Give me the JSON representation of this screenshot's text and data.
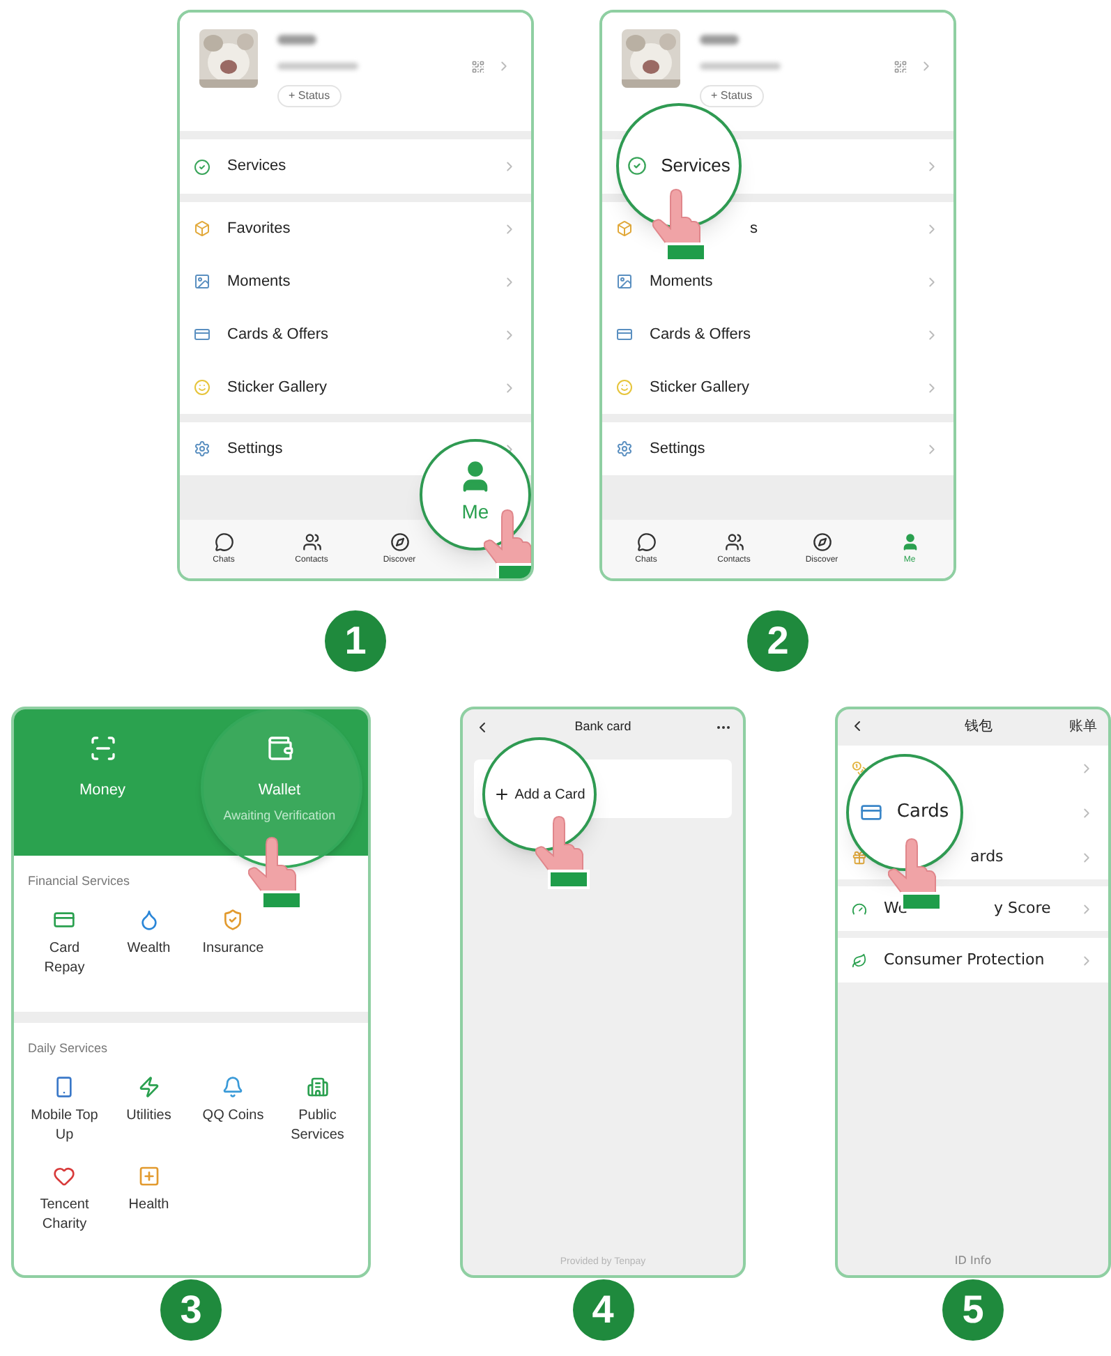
{
  "screens": [
    {
      "kind": "profile",
      "step": "1",
      "status_button": "+ Status",
      "sections": [
        [
          {
            "label": "Services",
            "magnified": false
          }
        ],
        [
          {
            "label": "Favorites",
            "magnified": false
          },
          {
            "label": "Moments",
            "magnified": false
          },
          {
            "label": "Cards & Offers",
            "magnified": false
          },
          {
            "label": "Sticker Gallery",
            "magnified": false
          }
        ],
        [
          {
            "label": "Settings",
            "magnified": false
          }
        ]
      ],
      "tabs": [
        {
          "label": "Chats",
          "selected": false,
          "magnified": false
        },
        {
          "label": "Contacts",
          "selected": false,
          "magnified": false
        },
        {
          "label": "Discover",
          "selected": false,
          "magnified": false
        },
        {
          "label": "Me",
          "selected": true,
          "magnified": true
        }
      ]
    },
    {
      "kind": "profile",
      "step": "2",
      "status_button": "+ Status",
      "sections": [
        [
          {
            "label": "Services",
            "magnified": true
          }
        ],
        [
          {
            "label_tail": "s",
            "magnified": false
          },
          {
            "label": "Moments",
            "magnified": false
          },
          {
            "label": "Cards & Offers",
            "magnified": false
          },
          {
            "label": "Sticker Gallery",
            "magnified": false
          }
        ],
        [
          {
            "label": "Settings",
            "magnified": false
          }
        ]
      ],
      "tabs": [
        {
          "label": "Chats",
          "selected": false,
          "magnified": false
        },
        {
          "label": "Contacts",
          "selected": false,
          "magnified": false
        },
        {
          "label": "Discover",
          "selected": false,
          "magnified": false
        },
        {
          "label": "Me",
          "selected": true,
          "magnified": false
        }
      ]
    },
    {
      "kind": "services",
      "step": "3",
      "top_actions": [
        {
          "label": "Money",
          "magnified": false
        },
        {
          "label": "Wallet",
          "subtitle": "Awaiting Verification",
          "magnified": true
        }
      ],
      "sections": [
        {
          "title": "Financial Services",
          "items": [
            "Card Repay",
            "Wealth",
            "Insurance"
          ]
        },
        {
          "title": "Daily Services",
          "items": [
            "Mobile Top Up",
            "Utilities",
            "QQ Coins",
            "Public Services",
            "Tencent Charity",
            "Health"
          ]
        }
      ]
    },
    {
      "kind": "bank_card",
      "step": "4",
      "title": "Bank card",
      "card_action": {
        "label": "Add a Card",
        "magnified": true
      },
      "footer": "Provided by Tenpay"
    },
    {
      "kind": "wallet",
      "step": "5",
      "title": "钱包",
      "action": "账单",
      "groups": [
        [
          {
            "magnified": false
          },
          {
            "label": "Cards",
            "magnified": true
          },
          {
            "label_tail": "ards",
            "magnified": false
          }
        ],
        [
          {
            "label_head": "We",
            "label_tail": "y Score",
            "magnified": false
          }
        ],
        [
          {
            "label": "Consumer Protection",
            "magnified": false
          }
        ]
      ],
      "footer": "ID Info"
    }
  ]
}
